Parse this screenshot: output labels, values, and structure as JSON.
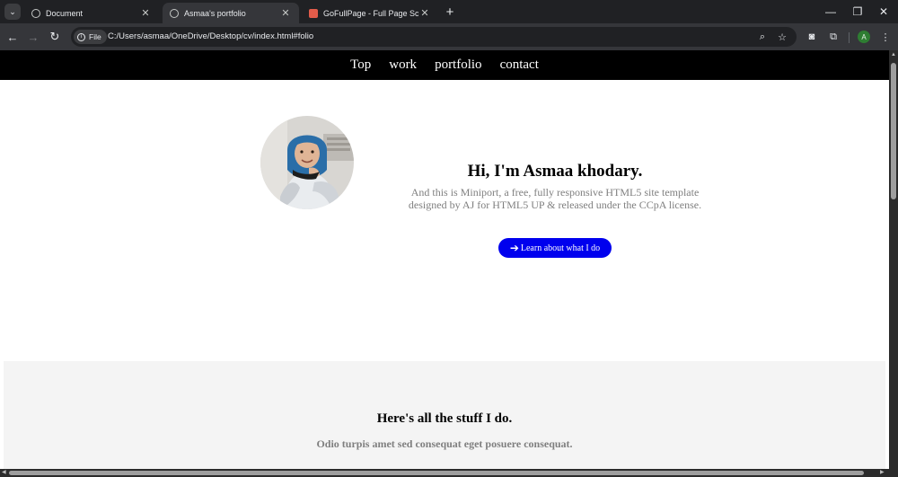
{
  "tabs": [
    {
      "title": "Document",
      "active": false
    },
    {
      "title": "Asmaa's portfolio",
      "active": true
    },
    {
      "title": "GoFullPage - Full Page Screen C",
      "active": false
    }
  ],
  "address_bar": {
    "chip": "File",
    "url": "C:/Users/asmaa/OneDrive/Desktop/cv/index.html#folio"
  },
  "profile_initial": "A",
  "site_nav": [
    "Top",
    "work",
    "portfolio",
    "contact"
  ],
  "hero": {
    "title": "Hi, I'm Asmaa khodary.",
    "description": "And this is Miniport, a free, fully responsive HTML5 site template designed by AJ for HTML5 UP & released under the CCpA license.",
    "button": "Learn about what I do"
  },
  "stuff": {
    "title": "Here's all the stuff I do.",
    "subtitle": "Odio turpis amet sed consequat eget posuere consequat."
  },
  "colors": {
    "nav_bg": "#000000",
    "button_bg": "#0000ee",
    "section_bg": "#f4f4f4",
    "muted_text": "#7f7f7f"
  }
}
